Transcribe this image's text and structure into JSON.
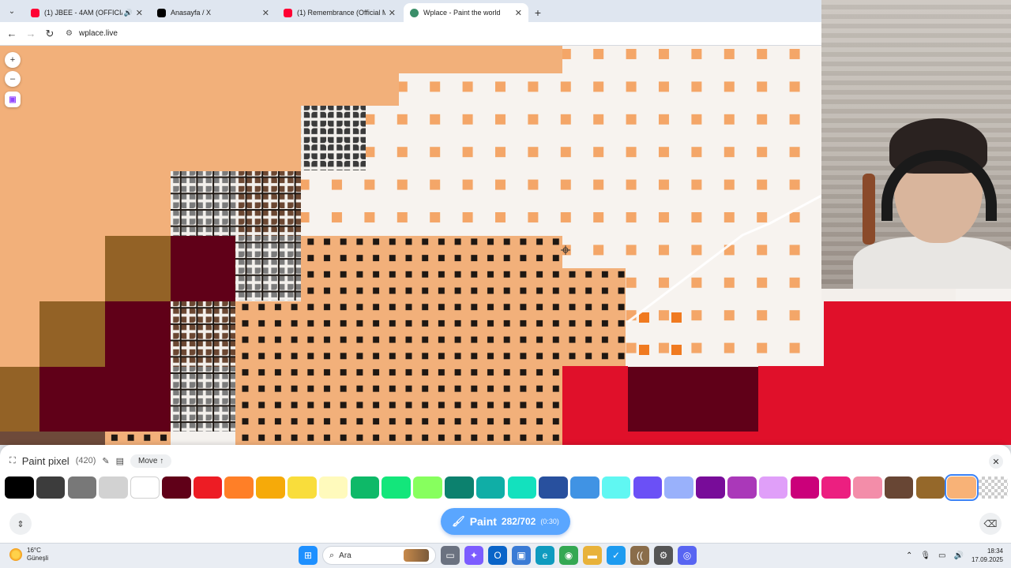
{
  "browser": {
    "tabs": [
      {
        "title": "(1) JBEE - 4AM (OFFICIAL VI",
        "favicon_color": "#ff0033",
        "active": false,
        "audio": true
      },
      {
        "title": "Anasayfa / X",
        "favicon_color": "#000000",
        "active": false,
        "audio": false
      },
      {
        "title": "(1) Remembrance (Official Mus",
        "favicon_color": "#ff0033",
        "active": false,
        "audio": false
      },
      {
        "title": "Wplace - Paint the world",
        "favicon_color": "#3b8f6a",
        "active": true,
        "audio": false
      }
    ],
    "url": "wplace.live",
    "icons": {
      "tab_menu": "chevron-down-icon",
      "new_tab": "plus-icon",
      "back": "arrow-left-icon",
      "forward": "arrow-right-icon",
      "reload": "reload-icon",
      "site_settings": "tune-icon",
      "close": "close-icon",
      "speaker": "speaker-icon"
    }
  },
  "map_controls": {
    "zoom_in": "+",
    "zoom_out": "–",
    "twitch": "twitch-icon"
  },
  "paint_panel": {
    "title": "Paint pixel",
    "count": "(420)",
    "move_label": "Move ↑",
    "paint_label": "Paint",
    "charges": "282/702",
    "timer": "(0:30)",
    "icons": [
      "pencil-icon",
      "grid-icon",
      "expand-icon",
      "close-icon",
      "eraser-icon",
      "brush-icon"
    ],
    "palette": [
      "#000000",
      "#3c3c3c",
      "#787878",
      "#d2d2d2",
      "#ffffff",
      "#600018",
      "#ed1c24",
      "#ff7f27",
      "#f6aa09",
      "#f9dd3b",
      "#fffabc",
      "#0eb968",
      "#13e67b",
      "#87ff5e",
      "#0c816e",
      "#10aea6",
      "#13e1be",
      "#28509e",
      "#4093e4",
      "#60f7f2",
      "#6b50f6",
      "#99b1fb",
      "#780c99",
      "#aa38b9",
      "#e09ff9",
      "#cb007a",
      "#ec1f80",
      "#f38da9",
      "#684634",
      "#95682a",
      "#f8b277",
      "transparent"
    ],
    "selected_color": "#f8b277"
  },
  "taskbar": {
    "weather_temp": "16°C",
    "weather_desc": "Güneşli",
    "search_placeholder": "Ara",
    "time": "18:34",
    "date": "17.09.2025",
    "app_icons": [
      "windows-start-icon",
      "file-explorer-icon",
      "copilot-icon",
      "outlook-icon",
      "store-icon",
      "edge-icon",
      "chrome-icon",
      "folder-icon",
      "twitter-icon",
      "audio-app-icon",
      "settings-icon",
      "discord-icon"
    ]
  }
}
